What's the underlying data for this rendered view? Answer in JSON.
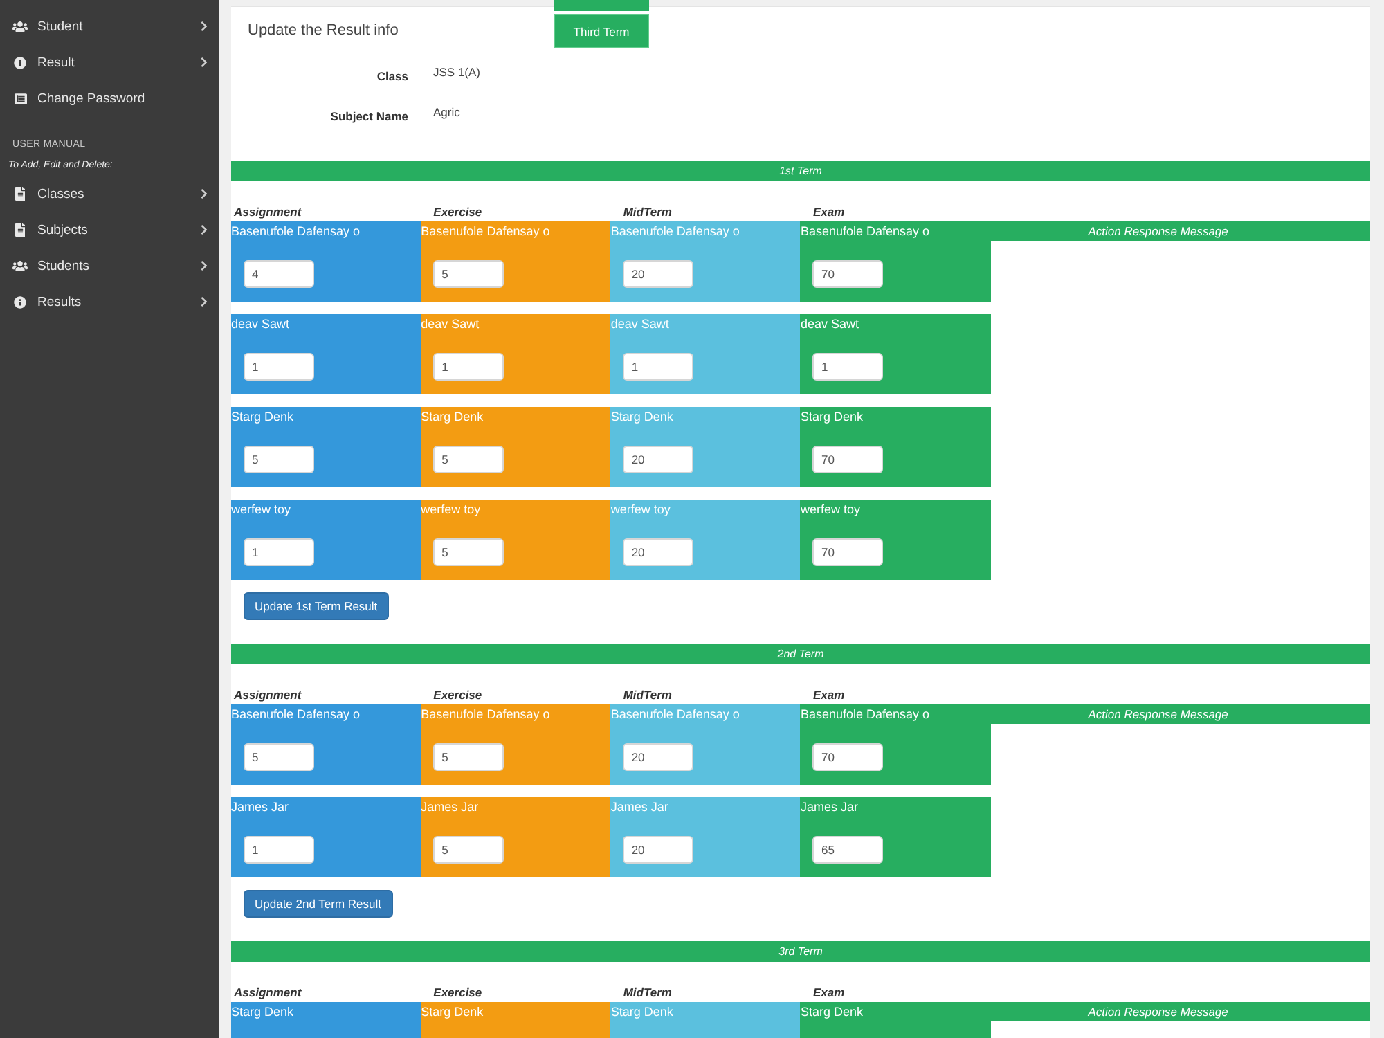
{
  "sidebar": {
    "menu": [
      {
        "label": "Student",
        "expandable": true
      },
      {
        "label": "Result",
        "expandable": true
      },
      {
        "label": "Change Password",
        "expandable": false
      }
    ],
    "manual": {
      "heading": "USER MANUAL",
      "note": "To Add, Edit and Delete:",
      "items": [
        {
          "label": "Classes",
          "expandable": true
        },
        {
          "label": "Subjects",
          "expandable": true
        },
        {
          "label": "Students",
          "expandable": true
        },
        {
          "label": "Results",
          "expandable": true
        }
      ]
    }
  },
  "panel": {
    "title": "Update the Result info",
    "term_button": "Third Term",
    "info": [
      {
        "label": "Class",
        "value": "JSS 1(A)"
      },
      {
        "label": "Subject Name",
        "value": "Agric"
      }
    ]
  },
  "terms": [
    {
      "title": "1st Term",
      "columns": [
        {
          "label": "Assignment",
          "color": "#3498db"
        },
        {
          "label": "Exercise",
          "color": "#f39c12"
        },
        {
          "label": "MidTerm",
          "color": "#5bc0de"
        },
        {
          "label": "Exam",
          "color": "#27ae60"
        }
      ],
      "response_heading": "Action Response Message",
      "rows": [
        {
          "cells": [
            {
              "name": "Basenufole Dafensay o",
              "value": "4"
            },
            {
              "name": "Basenufole Dafensay o",
              "value": "5"
            },
            {
              "name": "Basenufole Dafensay o",
              "value": "20"
            },
            {
              "name": "Basenufole Dafensay o",
              "value": "70"
            }
          ]
        },
        {
          "cells": [
            {
              "name": "deav Sawt",
              "value": "1"
            },
            {
              "name": "deav Sawt",
              "value": "1"
            },
            {
              "name": "deav Sawt",
              "value": "1"
            },
            {
              "name": "deav Sawt",
              "value": "1"
            }
          ]
        },
        {
          "cells": [
            {
              "name": "Starg Denk",
              "value": "5"
            },
            {
              "name": "Starg Denk",
              "value": "5"
            },
            {
              "name": "Starg Denk",
              "value": "20"
            },
            {
              "name": "Starg Denk",
              "value": "70"
            }
          ]
        },
        {
          "cells": [
            {
              "name": "werfew toy",
              "value": "1"
            },
            {
              "name": "werfew toy",
              "value": "5"
            },
            {
              "name": "werfew toy",
              "value": "20"
            },
            {
              "name": "werfew toy",
              "value": "70"
            }
          ]
        }
      ],
      "button": "Update 1st Term Result"
    },
    {
      "title": "2nd Term",
      "columns": [
        {
          "label": "Assignment",
          "color": "#3498db"
        },
        {
          "label": "Exercise",
          "color": "#f39c12"
        },
        {
          "label": "MidTerm",
          "color": "#5bc0de"
        },
        {
          "label": "Exam",
          "color": "#27ae60"
        }
      ],
      "response_heading": "Action Response Message",
      "rows": [
        {
          "cells": [
            {
              "name": "Basenufole Dafensay o",
              "value": "5"
            },
            {
              "name": "Basenufole Dafensay o",
              "value": "5"
            },
            {
              "name": "Basenufole Dafensay o",
              "value": "20"
            },
            {
              "name": "Basenufole Dafensay o",
              "value": "70"
            }
          ]
        },
        {
          "cells": [
            {
              "name": "James Jar",
              "value": "1"
            },
            {
              "name": "James Jar",
              "value": "5"
            },
            {
              "name": "James Jar",
              "value": "20"
            },
            {
              "name": "James Jar",
              "value": "65"
            }
          ]
        }
      ],
      "button": "Update 2nd Term Result"
    },
    {
      "title": "3rd Term",
      "columns": [
        {
          "label": "Assignment",
          "color": "#3498db"
        },
        {
          "label": "Exercise",
          "color": "#f39c12"
        },
        {
          "label": "MidTerm",
          "color": "#5bc0de"
        },
        {
          "label": "Exam",
          "color": "#27ae60"
        }
      ],
      "response_heading": "Action Response Message",
      "rows": [
        {
          "cells": [
            {
              "name": "Starg Denk"
            },
            {
              "name": "Starg Denk"
            },
            {
              "name": "Starg Denk"
            },
            {
              "name": "Starg Denk"
            }
          ]
        }
      ]
    }
  ]
}
